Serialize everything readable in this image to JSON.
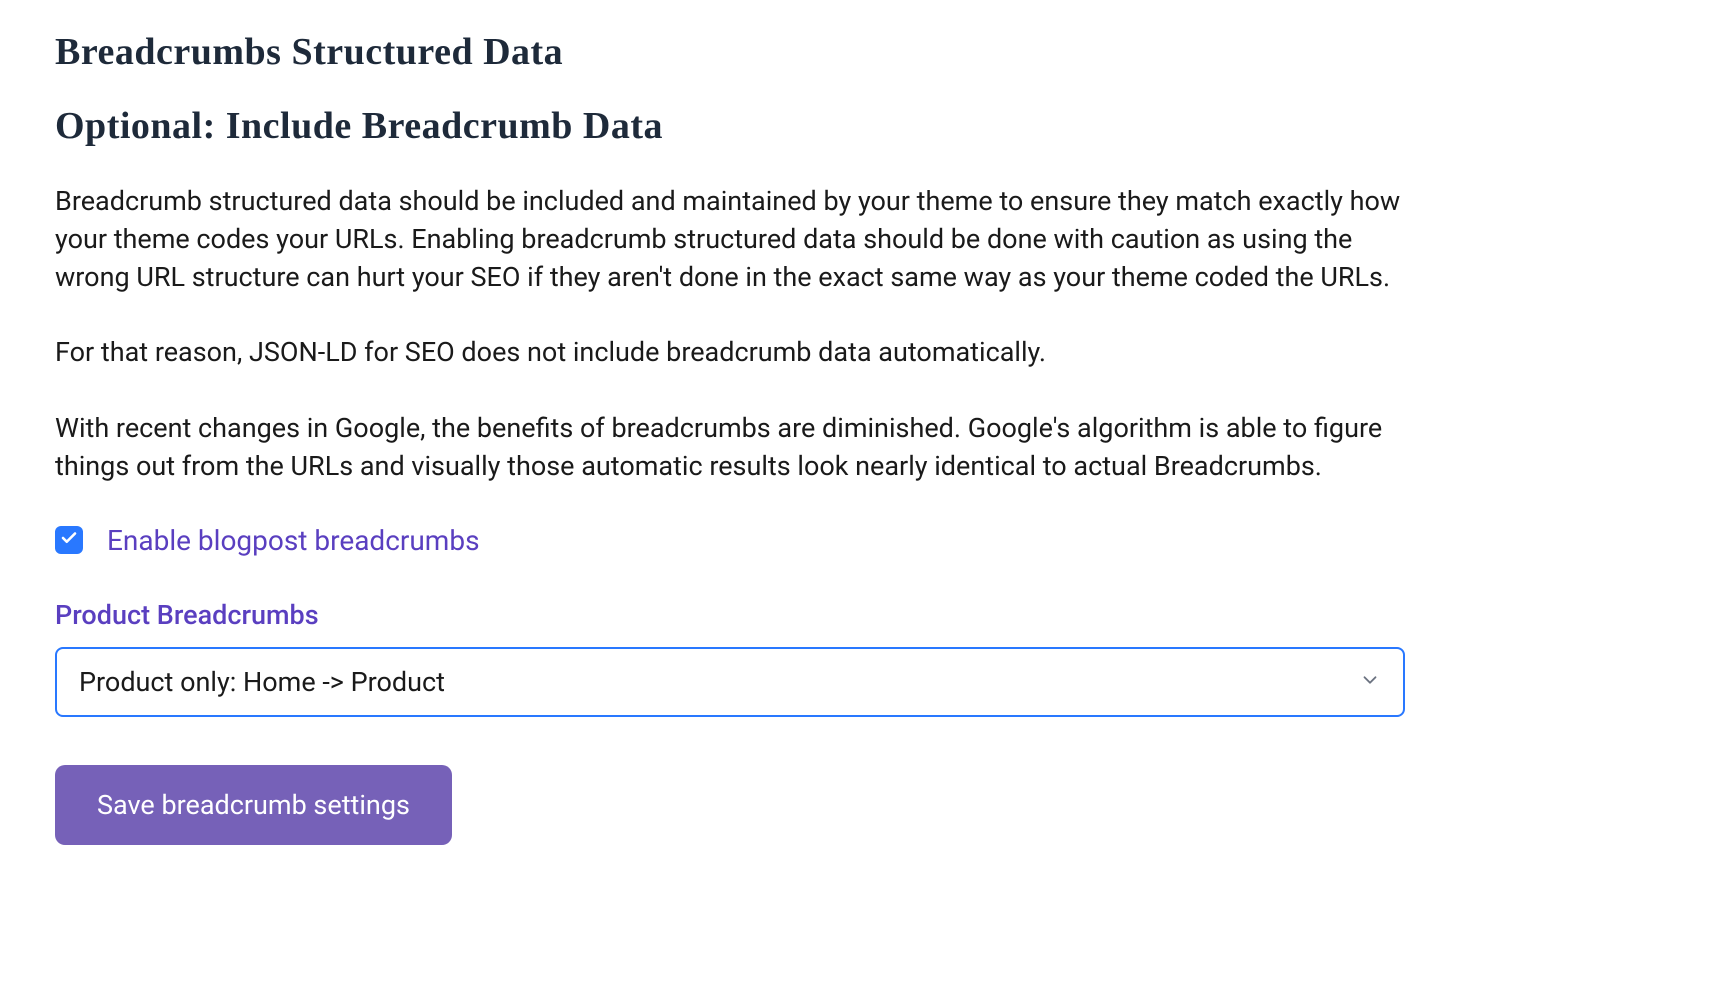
{
  "headings": {
    "main_title": "Breadcrumbs Structured Data",
    "sub_title": "Optional: Include Breadcrumb Data"
  },
  "paragraphs": {
    "p1": "Breadcrumb structured data should be included and maintained by your theme to ensure they match exactly how your theme codes your URLs. Enabling breadcrumb structured data should be done with caution as using the wrong URL structure can hurt your SEO if they aren't done in the exact same way as your theme coded the URLs.",
    "p2": "For that reason, JSON-LD for SEO does not include breadcrumb data automatically.",
    "p3": "With recent changes in Google, the benefits of breadcrumbs are diminished. Google's algorithm is able to figure things out from the URLs and visually those automatic results look nearly identical to actual Breadcrumbs."
  },
  "checkbox": {
    "label": "Enable blogpost breadcrumbs",
    "checked": true
  },
  "select": {
    "label": "Product Breadcrumbs",
    "value": "Product only: Home -> Product"
  },
  "buttons": {
    "save": "Save breadcrumb settings"
  },
  "colors": {
    "accent_purple": "#5a3fc0",
    "button_purple": "#7661b8",
    "checkbox_blue": "#2978ff",
    "border_blue": "#2978ff",
    "heading_dark": "#1e2a3a"
  }
}
